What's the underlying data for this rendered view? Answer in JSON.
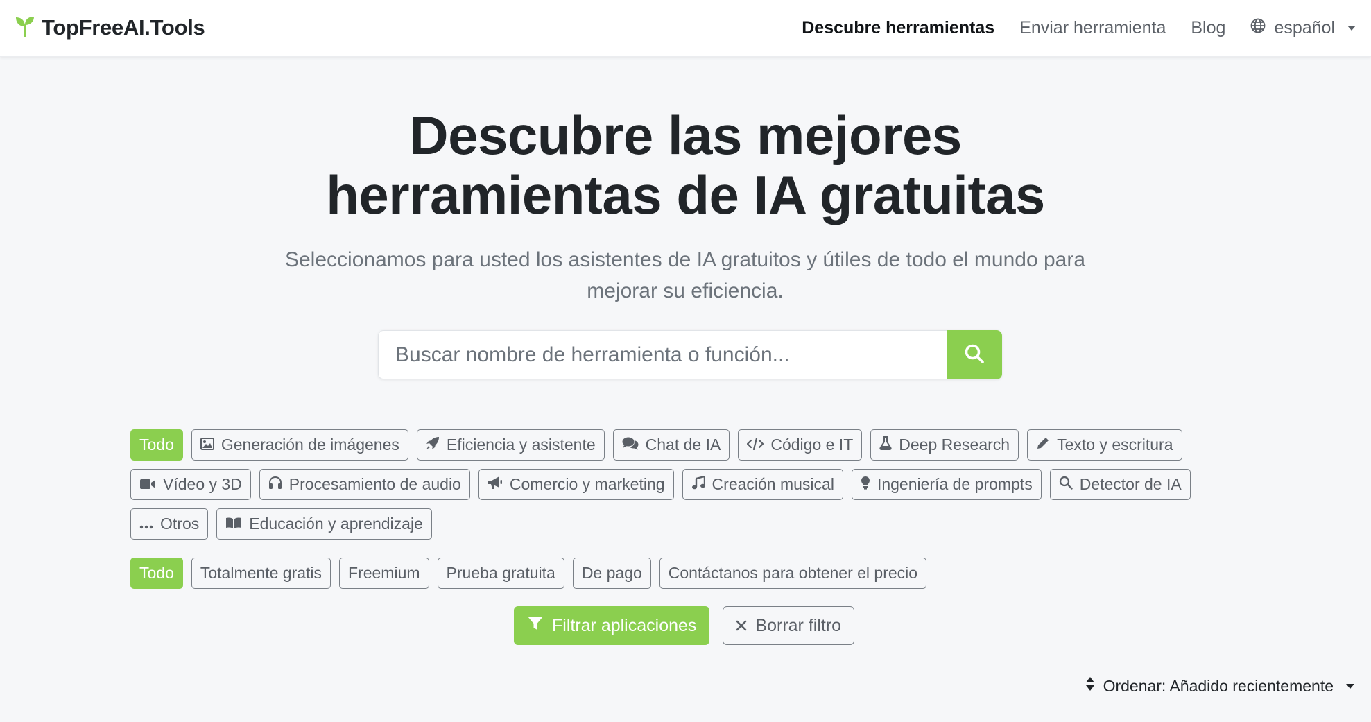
{
  "brand": {
    "name": "TopFreeAI.Tools",
    "logo_icon": "sprout-icon",
    "color": "#8bcf4f"
  },
  "nav": {
    "discover": "Descubre herramientas",
    "submit": "Enviar herramienta",
    "blog": "Blog",
    "language": "español"
  },
  "hero": {
    "title_line1": "Descubre las mejores",
    "title_line2": "herramientas de IA gratuitas",
    "subtitle": "Seleccionamos para usted los asistentes de IA gratuitos y útiles de todo el mundo para mejorar su eficiencia."
  },
  "search": {
    "placeholder": "Buscar nombre de herramienta o función..."
  },
  "categories": [
    {
      "label": "Todo",
      "icon": "",
      "active": true
    },
    {
      "label": "Generación de imágenes",
      "icon": "image-icon"
    },
    {
      "label": "Eficiencia y asistente",
      "icon": "rocket-icon"
    },
    {
      "label": "Chat de IA",
      "icon": "comments-icon"
    },
    {
      "label": "Código e IT",
      "icon": "code-icon"
    },
    {
      "label": "Deep Research",
      "icon": "flask-icon"
    },
    {
      "label": "Texto y escritura",
      "icon": "pencil-icon"
    },
    {
      "label": "Vídeo y 3D",
      "icon": "video-icon"
    },
    {
      "label": "Procesamiento de audio",
      "icon": "headphones-icon"
    },
    {
      "label": "Comercio y marketing",
      "icon": "megaphone-icon"
    },
    {
      "label": "Creación musical",
      "icon": "music-icon"
    },
    {
      "label": "Ingeniería de prompts",
      "icon": "lightbulb-icon"
    },
    {
      "label": "Detector de IA",
      "icon": "search-icon"
    },
    {
      "label": "Otros",
      "icon": "ellipsis-icon"
    },
    {
      "label": "Educación y aprendizaje",
      "icon": "book-icon"
    }
  ],
  "pricing": [
    {
      "label": "Todo",
      "active": true
    },
    {
      "label": "Totalmente gratis"
    },
    {
      "label": "Freemium"
    },
    {
      "label": "Prueba gratuita"
    },
    {
      "label": "De pago"
    },
    {
      "label": "Contáctanos para obtener el precio"
    }
  ],
  "actions": {
    "filter": "Filtrar aplicaciones",
    "clear": "Borrar filtro"
  },
  "sort": {
    "label": "Ordenar: Añadido recientemente"
  }
}
